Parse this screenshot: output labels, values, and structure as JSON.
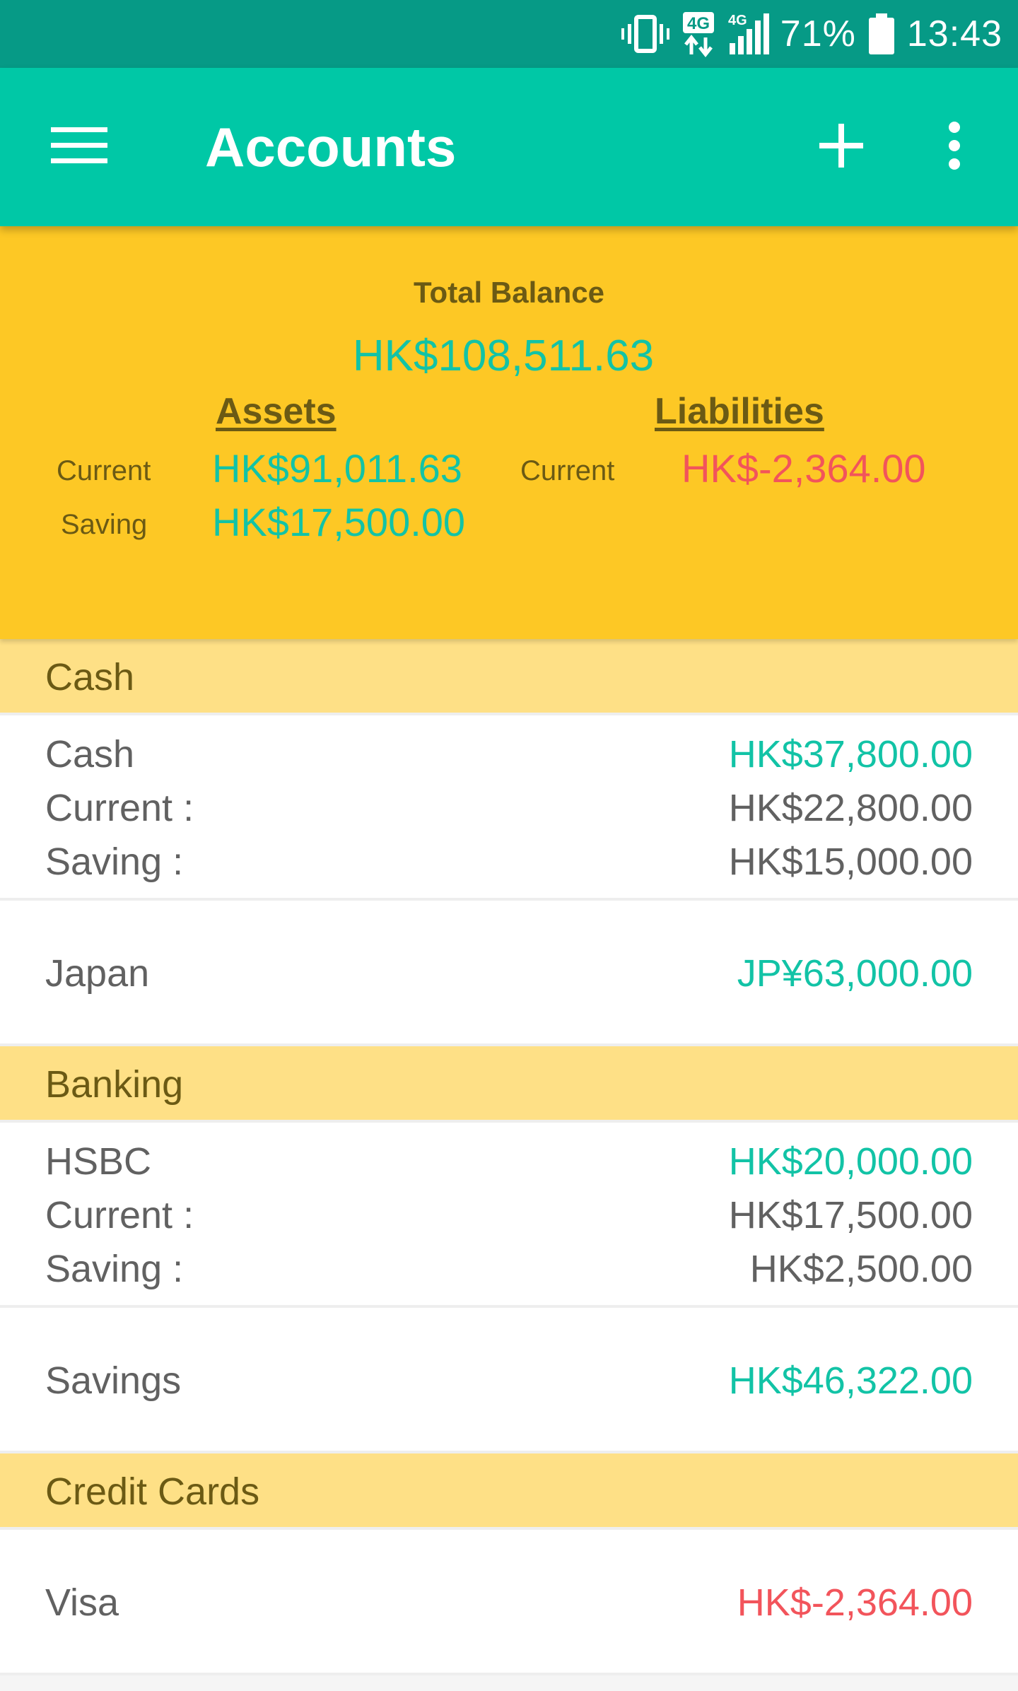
{
  "status_bar": {
    "battery": "71%",
    "time": "13:43",
    "network_1": "4G",
    "network_2": "4G",
    "icons": [
      "vibrate-icon",
      "data-4g-icon",
      "signal-icon",
      "battery-icon"
    ]
  },
  "app_bar": {
    "title": "Accounts",
    "icons": [
      "menu-icon",
      "add-icon",
      "more-vert-icon"
    ]
  },
  "summary": {
    "total_label": "Total Balance",
    "total_value": "HK$108,511.63",
    "assets_header": "Assets",
    "liabilities_header": "Liabilities",
    "assets": [
      {
        "label": "Current",
        "value": "HK$91,011.63"
      },
      {
        "label": "Saving",
        "value": "HK$17,500.00"
      }
    ],
    "liabilities": [
      {
        "label": "Current",
        "value": "HK$-2,364.00"
      }
    ]
  },
  "sections": [
    {
      "title": "Cash",
      "accounts": [
        {
          "name": "Cash",
          "amount": "HK$37,800.00",
          "current_label": "Current :",
          "current_value": "HK$22,800.00",
          "saving_label": "Saving :",
          "saving_value": "HK$15,000.00"
        },
        {
          "name": "Japan",
          "amount": "JP¥63,000.00"
        }
      ]
    },
    {
      "title": "Banking",
      "accounts": [
        {
          "name": "HSBC",
          "amount": "HK$20,000.00",
          "current_label": "Current :",
          "current_value": "HK$17,500.00",
          "saving_label": "Saving :",
          "saving_value": "HK$2,500.00"
        },
        {
          "name": "Savings",
          "amount": "HK$46,322.00"
        }
      ]
    },
    {
      "title": "Credit Cards",
      "accounts": [
        {
          "name": "Visa",
          "amount": "HK$-2,364.00"
        }
      ]
    }
  ],
  "colors": {
    "status_bar": "#069a86",
    "app_bar": "#00c8a6",
    "summary_bg": "#fdc825",
    "section_header_bg": "#fee086",
    "positive": "#12c3a6",
    "negative": "#f2545b",
    "label_brown": "#6b5a14"
  }
}
